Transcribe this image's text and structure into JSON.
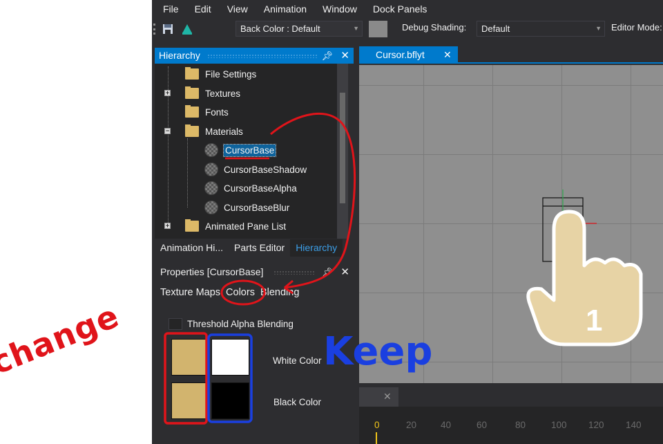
{
  "menubar": {
    "items": [
      "File",
      "Edit",
      "View",
      "Animation",
      "Window",
      "Dock Panels"
    ]
  },
  "toolbar": {
    "back_color": "Back Color : Default",
    "debug_shading_label": "Debug Shading:",
    "debug_shading_value": "Default",
    "editor_mode_label": "Editor Mode:"
  },
  "hierarchy": {
    "title": "Hierarchy",
    "items": [
      {
        "label": "File Settings",
        "type": "folder"
      },
      {
        "label": "Textures",
        "type": "folder"
      },
      {
        "label": "Fonts",
        "type": "folder"
      },
      {
        "label": "Materials",
        "type": "folder"
      },
      {
        "label": "CursorBase",
        "type": "material",
        "selected": true
      },
      {
        "label": "CursorBaseShadow",
        "type": "material"
      },
      {
        "label": "CursorBaseAlpha",
        "type": "material"
      },
      {
        "label": "CursorBaseBlur",
        "type": "material"
      },
      {
        "label": "Animated Pane List",
        "type": "folder"
      }
    ],
    "tabs": [
      "Animation Hi...",
      "Parts Editor",
      "Hierarchy"
    ]
  },
  "properties": {
    "title": "Properties [CursorBase]",
    "tabs": [
      "Texture Maps",
      "Colors",
      "Blending"
    ],
    "threshold_label": "Threshold Alpha Blending",
    "white_color_label": "White Color",
    "black_color_label": "Black Color",
    "colors": {
      "gold": "#d2b46e",
      "white": "#ffffff",
      "black": "#000000"
    }
  },
  "document": {
    "tab": "Cursor.bflyt",
    "cursor_number": "1"
  },
  "timeline": {
    "ticks": [
      "0",
      "20",
      "40",
      "60",
      "80",
      "100",
      "120",
      "140"
    ]
  },
  "annotations": {
    "change": "change",
    "keep": "Keep"
  },
  "accent_colors": {
    "selection_blue": "#007acc",
    "annotation_red": "#e0141a",
    "annotation_blue": "#1a3fe0"
  }
}
